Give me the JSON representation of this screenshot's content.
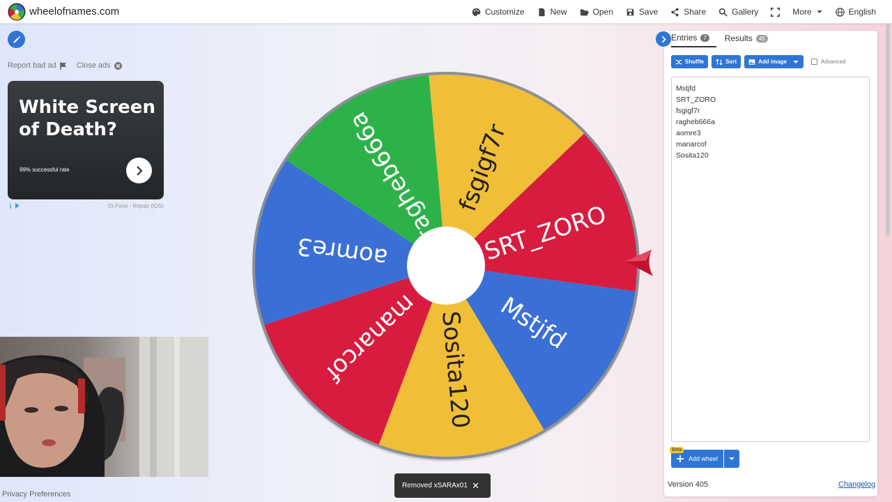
{
  "header": {
    "site_title": "wheelofnames.com",
    "menu": {
      "customize": "Customize",
      "new": "New",
      "open": "Open",
      "save": "Save",
      "share": "Share",
      "gallery": "Gallery",
      "more": "More",
      "language": "English"
    }
  },
  "ad": {
    "report": "Report bad ad",
    "close": "Close ads",
    "title": "White Screen of Death?",
    "subtitle": "99% successful rate",
    "source": "Dr.Fone - Repair (iOS)"
  },
  "wheel": {
    "segments": [
      {
        "label": "SRT_ZORO",
        "color": "#d81c3f"
      },
      {
        "label": "Mstjfd",
        "color": "#3a6fd6"
      },
      {
        "label": "Sosita120",
        "color": "#f1be37"
      },
      {
        "label": "manarcof",
        "color": "#d81c3f"
      },
      {
        "label": "aomre3",
        "color": "#3a6fd6"
      },
      {
        "label": "ragheb666a",
        "color": "#2db24a"
      },
      {
        "label": "fsgigf7r",
        "color": "#f1be37"
      }
    ]
  },
  "toast": {
    "message": "Removed xSARAx01",
    "close": "✕"
  },
  "panel": {
    "tabs": {
      "entries": "Entries",
      "entries_count": "7",
      "results": "Results",
      "results_count": "45"
    },
    "toolbar": {
      "shuffle": "Shuffle",
      "sort": "Sort",
      "add_image": "Add image",
      "advanced": "Advanced"
    },
    "entries": [
      "Mstjfd",
      "SRT_ZORO",
      "fsgigf7r",
      "ragheb666a",
      "aomre3",
      "manarcof",
      "Sosita120"
    ],
    "beta": "Beta",
    "add_wheel": "Add wheel",
    "version": "Version 405",
    "changelog": "Changelog"
  },
  "footer": {
    "privacy": "Privacy Preferences"
  },
  "colors": {
    "accent": "#2e75d6",
    "red": "#d81c3f",
    "blue": "#3a6fd6",
    "yellow": "#f1be37",
    "green": "#2db24a"
  },
  "icons": [
    "palette-icon",
    "file-icon",
    "folder-open-icon",
    "save-icon",
    "share-icon",
    "search-icon",
    "fullscreen-icon",
    "chevron-down-icon",
    "globe-icon",
    "pencil-icon",
    "flag-icon",
    "close-circle-icon",
    "chevron-right-icon",
    "shuffle-icon",
    "sort-icon",
    "image-icon",
    "plus-icon"
  ]
}
